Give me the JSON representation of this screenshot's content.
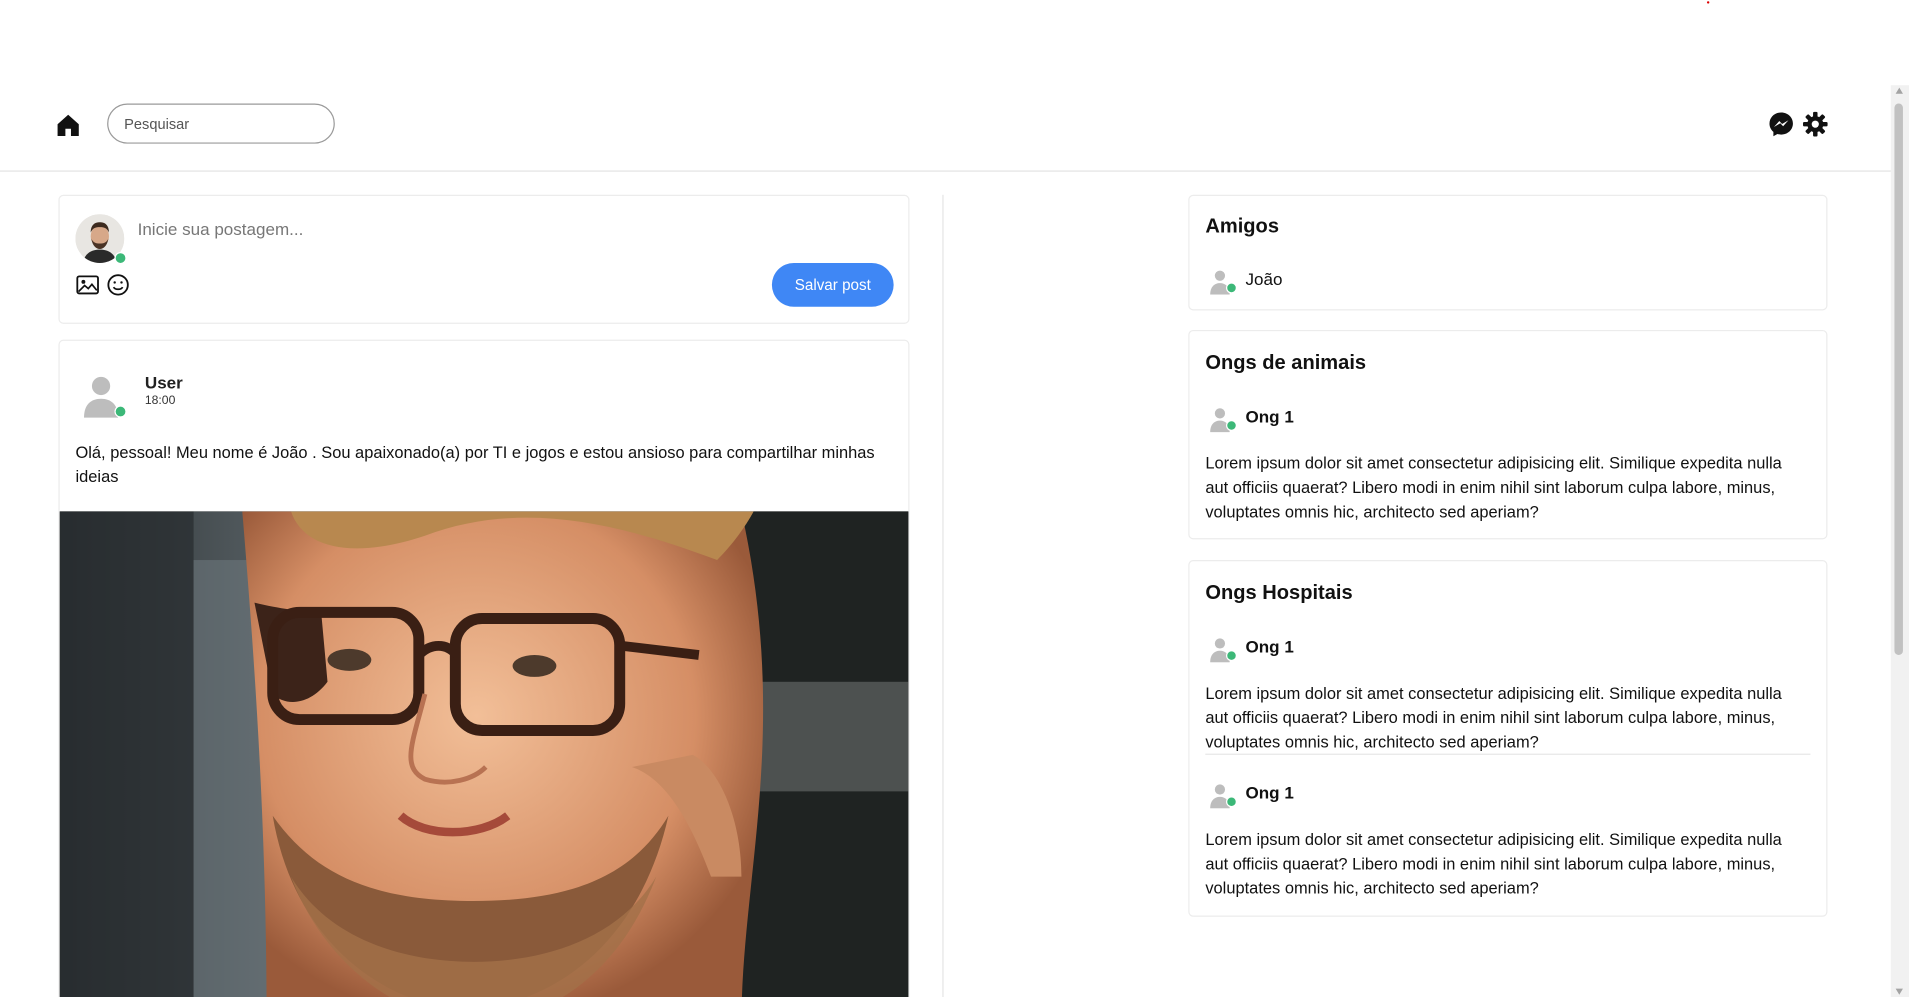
{
  "header": {
    "search_placeholder": "Pesquisar",
    "icons": [
      "home-icon",
      "messenger-icon",
      "gear-icon"
    ]
  },
  "composer": {
    "placeholder": "Inicie sua postagem...",
    "save_label": "Salvar post",
    "icons": [
      "image-icon",
      "emoji-icon"
    ]
  },
  "post": {
    "user": "User",
    "time": "18:00",
    "text": "Olá, pessoal! Meu nome é João . Sou apaixonado(a) por TI e jogos e estou ansioso para compartilhar minhas ideias"
  },
  "friends": {
    "title": "Amigos",
    "items": [
      {
        "name": "João"
      }
    ]
  },
  "ong_animals": {
    "title": "Ongs de animais",
    "items": [
      {
        "name": "Ong 1",
        "description": "Lorem ipsum dolor sit amet consectetur adipisicing elit. Similique expedita nulla aut officiis quaerat? Libero modi in enim nihil sint laborum culpa labore, minus, voluptates omnis hic, architecto sed aperiam?"
      }
    ]
  },
  "ong_hospitals": {
    "title": "Ongs Hospitais",
    "items": [
      {
        "name": "Ong 1",
        "description": "Lorem ipsum dolor sit amet consectetur adipisicing elit. Similique expedita nulla aut officiis quaerat? Libero modi in enim nihil sint laborum culpa labore, minus, voluptates omnis hic, architecto sed aperiam?"
      },
      {
        "name": "Ong 1",
        "description": "Lorem ipsum dolor sit amet consectetur adipisicing elit. Similique expedita nulla aut officiis quaerat? Libero modi in enim nihil sint laborum culpa labore, minus, voluptates omnis hic, architecto sed aperiam?"
      }
    ]
  },
  "colors": {
    "accent": "#3f87f5",
    "online": "#3cb878",
    "border": "#ececec"
  }
}
